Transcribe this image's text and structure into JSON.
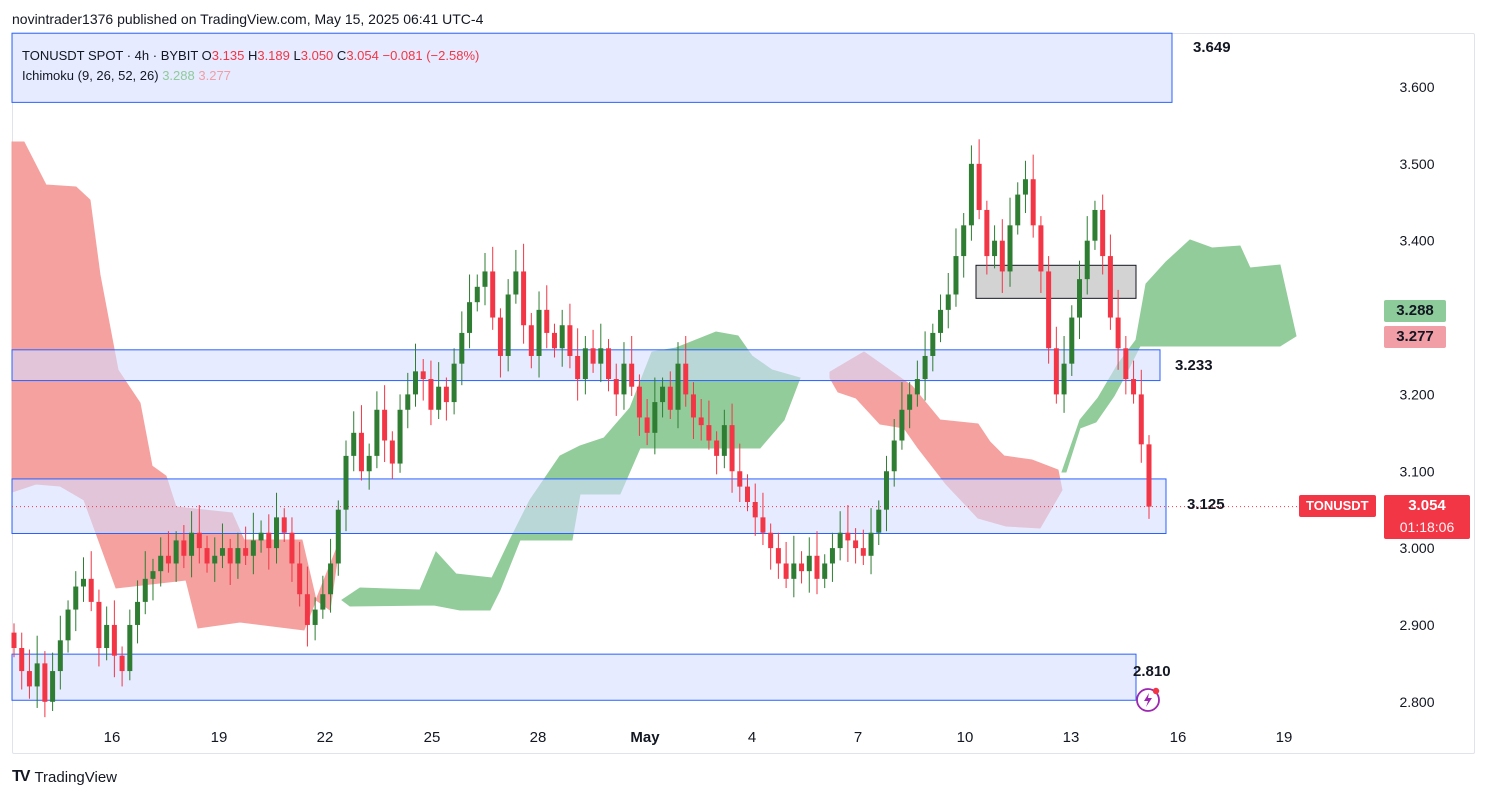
{
  "header": {
    "publisher": "novintrader1376 published on TradingView.com, May 15, 2025 06:41 UTC-4"
  },
  "legend": {
    "symbol": "TONUSDT SPOT · 4h · BYBIT",
    "o_label": "O",
    "o_value": "3.135",
    "h_label": "H",
    "h_value": "3.189",
    "l_label": "L",
    "l_value": "3.050",
    "c_label": "C",
    "c_value": "3.054",
    "change": "−0.081 (−2.58%)",
    "indicator_name": "Ichimoku (9, 26, 52, 26)",
    "indicator_v1": "3.288",
    "indicator_v2": "3.277"
  },
  "price_axis": {
    "ticks": [
      "3.600",
      "3.500",
      "3.400",
      "3.200",
      "3.100",
      "3.000",
      "2.900",
      "2.800"
    ]
  },
  "time_axis": {
    "ticks": [
      "16",
      "19",
      "22",
      "25",
      "28",
      "May",
      "4",
      "7",
      "10",
      "13",
      "16",
      "19"
    ]
  },
  "current_price": {
    "ticker": "TONUSDT",
    "price": "3.054",
    "countdown": "01:18:06"
  },
  "indicator_tags": {
    "upper": "3.288",
    "lower": "3.277"
  },
  "zone_labels": {
    "top": "3.649",
    "mid": "3.233",
    "low": "3.125",
    "bottom": "2.810"
  },
  "colors": {
    "bull": "#2e7d32",
    "bear": "#f23645",
    "cloud_bull": "#7fc48a",
    "cloud_bear": "#f4918f",
    "zone_fill": "#d6deff",
    "zone_border": "#2962ff",
    "ticker_tag": "#f23645"
  },
  "footer": {
    "brand": "TradingView"
  },
  "chart_data": {
    "type": "candlestick",
    "symbol": "TONUSDT",
    "interval": "4h",
    "exchange": "BYBIT",
    "ylim": [
      2.78,
      3.67
    ],
    "y_ticks": [
      2.8,
      2.9,
      3.0,
      3.1,
      3.2,
      3.4,
      3.5,
      3.6
    ],
    "x_ticks": [
      "16",
      "19",
      "22",
      "25",
      "28",
      "May",
      "4",
      "7",
      "10",
      "13",
      "16",
      "19"
    ],
    "last_close": 3.054,
    "ichimoku_last": {
      "span_a": 3.288,
      "span_b": 3.277
    },
    "zones": [
      {
        "label": "3.649",
        "from": 3.58,
        "to": 3.67
      },
      {
        "label": "3.233",
        "from": 3.218,
        "to": 3.258
      },
      {
        "label": "3.125",
        "from": 3.019,
        "to": 3.09
      },
      {
        "label": "2.810",
        "from": 2.802,
        "to": 2.862
      }
    ],
    "consolidation_box": {
      "from": 3.325,
      "to": 3.368
    },
    "approx_closes": [
      2.87,
      2.84,
      2.82,
      2.85,
      2.8,
      2.84,
      2.88,
      2.92,
      2.95,
      2.96,
      2.93,
      2.87,
      2.9,
      2.86,
      2.84,
      2.9,
      2.93,
      2.96,
      2.97,
      2.99,
      2.98,
      3.01,
      2.99,
      3.02,
      3.0,
      2.98,
      2.99,
      3.0,
      2.98,
      3.0,
      2.99,
      3.01,
      3.02,
      3.0,
      3.04,
      3.02,
      2.98,
      2.94,
      2.9,
      2.92,
      2.94,
      2.98,
      3.05,
      3.12,
      3.15,
      3.1,
      3.12,
      3.18,
      3.14,
      3.11,
      3.18,
      3.2,
      3.23,
      3.22,
      3.18,
      3.21,
      3.19,
      3.24,
      3.28,
      3.32,
      3.34,
      3.36,
      3.3,
      3.25,
      3.33,
      3.36,
      3.29,
      3.25,
      3.31,
      3.28,
      3.26,
      3.29,
      3.25,
      3.22,
      3.26,
      3.24,
      3.26,
      3.22,
      3.2,
      3.24,
      3.21,
      3.17,
      3.15,
      3.19,
      3.21,
      3.18,
      3.24,
      3.2,
      3.17,
      3.16,
      3.14,
      3.12,
      3.16,
      3.1,
      3.08,
      3.06,
      3.04,
      3.02,
      3.0,
      2.98,
      2.96,
      2.98,
      2.97,
      2.99,
      2.96,
      2.98,
      3.0,
      3.02,
      3.01,
      3.0,
      2.99,
      3.02,
      3.05,
      3.1,
      3.14,
      3.18,
      3.2,
      3.22,
      3.25,
      3.28,
      3.31,
      3.33,
      3.38,
      3.42,
      3.5,
      3.44,
      3.38,
      3.4,
      3.36,
      3.42,
      3.46,
      3.48,
      3.42,
      3.36,
      3.26,
      3.2,
      3.24,
      3.3,
      3.35,
      3.4,
      3.44,
      3.38,
      3.3,
      3.26,
      3.22,
      3.2,
      3.135,
      3.054
    ]
  }
}
